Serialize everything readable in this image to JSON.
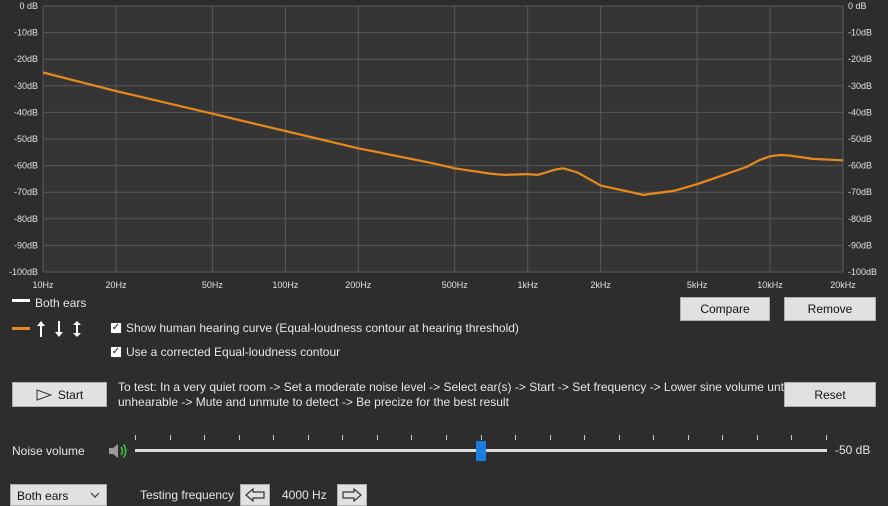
{
  "chart_data": {
    "type": "line",
    "x_scale": "log",
    "x_range": [
      10,
      20000
    ],
    "y_range": [
      -100,
      0
    ],
    "grid": true,
    "x_ticks": [
      {
        "v": 10,
        "label": "10Hz"
      },
      {
        "v": 20,
        "label": "20Hz"
      },
      {
        "v": 50,
        "label": "50Hz"
      },
      {
        "v": 100,
        "label": "100Hz"
      },
      {
        "v": 200,
        "label": "200Hz"
      },
      {
        "v": 500,
        "label": "500Hz"
      },
      {
        "v": 1000,
        "label": "1kHz"
      },
      {
        "v": 2000,
        "label": "2kHz"
      },
      {
        "v": 5000,
        "label": "5kHz"
      },
      {
        "v": 10000,
        "label": "10kHz"
      },
      {
        "v": 20000,
        "label": "20kHz"
      }
    ],
    "y_ticks_left": [
      {
        "v": 0,
        "label": "0 dB"
      },
      {
        "v": -10,
        "label": "-10dB"
      },
      {
        "v": -20,
        "label": "-20dB"
      },
      {
        "v": -30,
        "label": "-30dB"
      },
      {
        "v": -40,
        "label": "-40dB"
      },
      {
        "v": -50,
        "label": "-50dB"
      },
      {
        "v": -60,
        "label": "-60dB"
      },
      {
        "v": -70,
        "label": "-70dB"
      },
      {
        "v": -80,
        "label": "-80dB"
      },
      {
        "v": -90,
        "label": "-90dB"
      },
      {
        "v": -100,
        "label": "-100dB"
      }
    ],
    "y_ticks_right": [
      {
        "v": 0,
        "label": "0 dB"
      },
      {
        "v": -10,
        "label": "-10dB"
      },
      {
        "v": -20,
        "label": "-20dB"
      },
      {
        "v": -30,
        "label": "-30dB"
      },
      {
        "v": -40,
        "label": "-40dB"
      },
      {
        "v": -50,
        "label": "-50dB"
      },
      {
        "v": -60,
        "label": "-60dB"
      },
      {
        "v": -70,
        "label": "-70dB"
      },
      {
        "v": -80,
        "label": "-80dB"
      },
      {
        "v": -90,
        "label": "-90dB"
      },
      {
        "v": -100,
        "label": "-100dB"
      }
    ],
    "series": [
      {
        "color": "#e8891c",
        "points": [
          [
            10,
            -25
          ],
          [
            20,
            -32
          ],
          [
            50,
            -40.5
          ],
          [
            100,
            -47
          ],
          [
            200,
            -53.5
          ],
          [
            400,
            -59
          ],
          [
            500,
            -61
          ],
          [
            700,
            -63
          ],
          [
            800,
            -63.5
          ],
          [
            1000,
            -63.2
          ],
          [
            1100,
            -63.5
          ],
          [
            1300,
            -61.5
          ],
          [
            1400,
            -61
          ],
          [
            1600,
            -62.5
          ],
          [
            2000,
            -67.5
          ],
          [
            3000,
            -71
          ],
          [
            4000,
            -69.5
          ],
          [
            5000,
            -67
          ],
          [
            6000,
            -64.5
          ],
          [
            8000,
            -60.5
          ],
          [
            9000,
            -58
          ],
          [
            10000,
            -56.5
          ],
          [
            11000,
            -56
          ],
          [
            12000,
            -56.2
          ],
          [
            15000,
            -57.5
          ],
          [
            20000,
            -58
          ]
        ]
      }
    ]
  },
  "legend": {
    "both_ears_label": "Both ears",
    "line_color": "#e8891c",
    "white_line_color": "#ffffff"
  },
  "buttons": {
    "compare": "Compare",
    "remove": "Remove",
    "start": "Start",
    "reset": "Reset"
  },
  "checkboxes": {
    "show_curve_label": "Show human hearing curve (Equal-loudness contour at hearing threshold)",
    "show_curve_checked": true,
    "corrected_label": "Use a corrected Equal-loudness contour",
    "corrected_checked": true
  },
  "instructions": {
    "line1": "To test: In a very quiet room -> Set a moderate noise level -> Select ear(s) -> Start -> Set frequency -> Lower sine volume until",
    "line2": "unhearable -> Mute and unmute to detect -> Be precize for the best result"
  },
  "noise": {
    "label": "Noise volume",
    "value_label": "-50 dB",
    "slider_fraction": 0.5
  },
  "ear_select": {
    "value": "Both ears"
  },
  "frequency": {
    "label": "Testing frequency",
    "value": "4000 Hz"
  }
}
